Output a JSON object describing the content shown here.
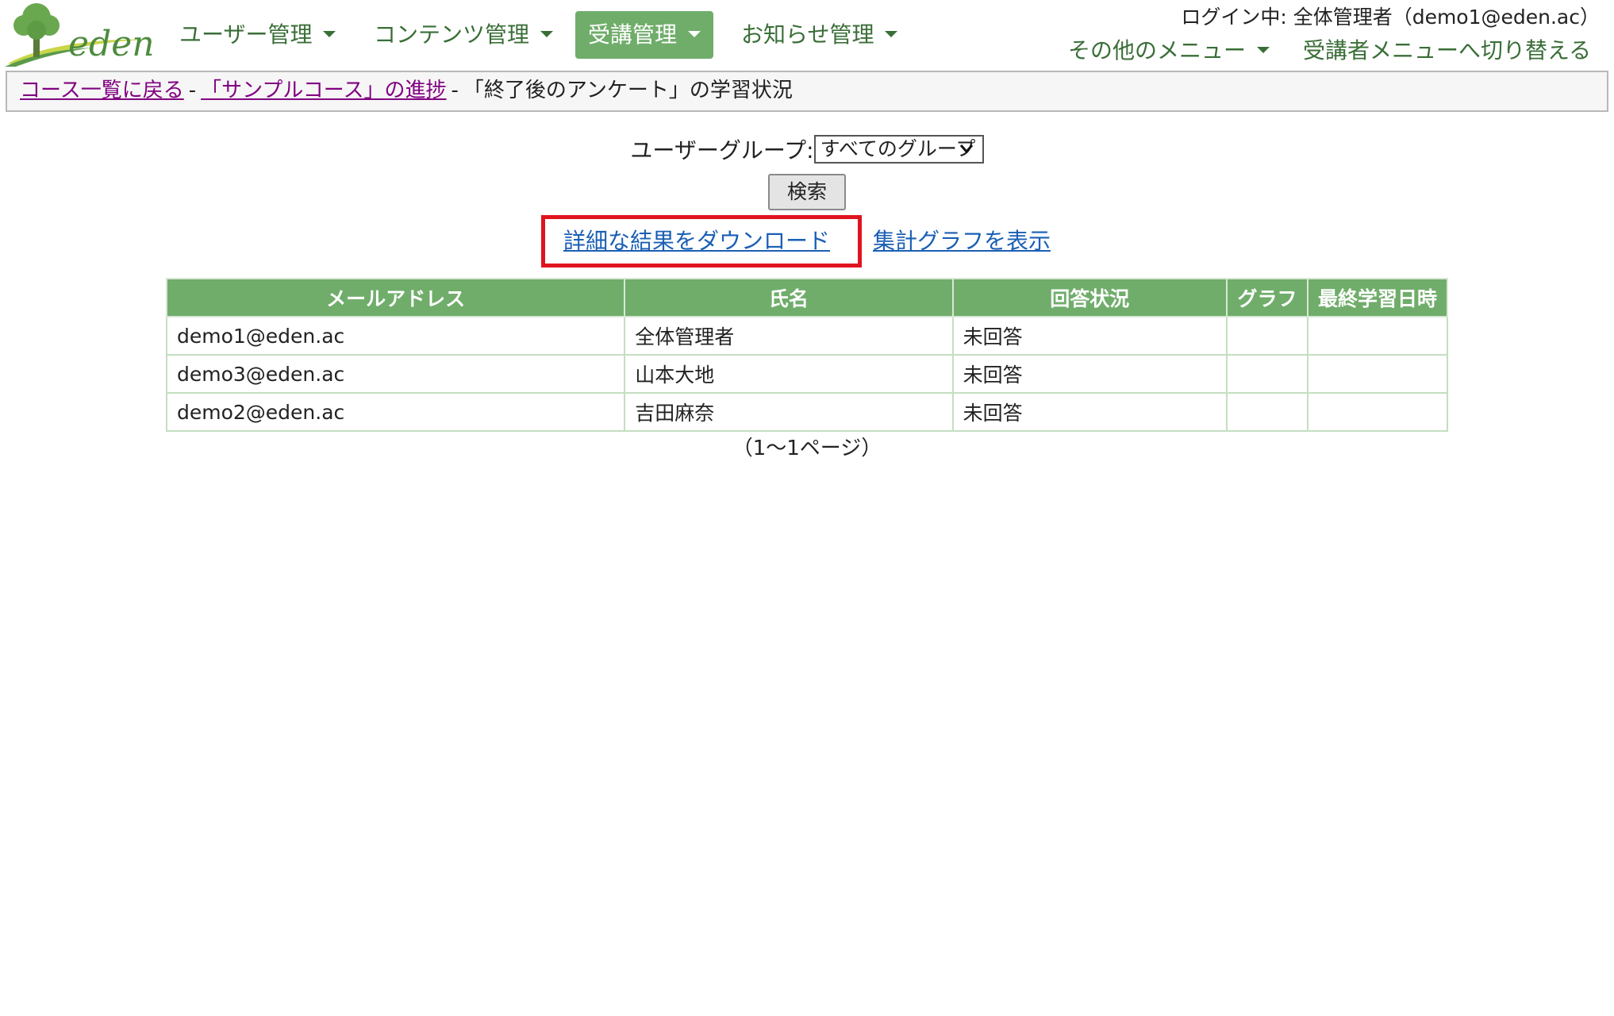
{
  "header": {
    "logo_text": "eden",
    "nav": [
      {
        "label": "ユーザー管理",
        "active": false
      },
      {
        "label": "コンテンツ管理",
        "active": false
      },
      {
        "label": "受講管理",
        "active": true
      },
      {
        "label": "お知らせ管理",
        "active": false
      }
    ],
    "login_info": "ログイン中: 全体管理者（demo1@eden.ac）",
    "other_menu": "その他のメニュー",
    "switch_menu": "受講者メニューへ切り替える"
  },
  "breadcrumb": {
    "link1": "コース一覧に戻る",
    "sep1": "-",
    "link2": "「サンプルコース」の進捗",
    "sep2": "-",
    "current": "「終了後のアンケート」の学習状況"
  },
  "filter": {
    "label": "ユーザーグループ:",
    "select_value": "すべてのグループ",
    "search_button": "検索"
  },
  "links": {
    "download": "詳細な結果をダウンロード",
    "graph": "集計グラフを表示"
  },
  "table": {
    "headers": [
      "メールアドレス",
      "氏名",
      "回答状況",
      "グラフ",
      "最終学習日時"
    ],
    "rows": [
      [
        "demo1@eden.ac",
        "全体管理者",
        "未回答",
        "",
        ""
      ],
      [
        "demo3@eden.ac",
        "山本大地",
        "未回答",
        "",
        ""
      ],
      [
        "demo2@eden.ac",
        "吉田麻奈",
        "未回答",
        "",
        ""
      ]
    ]
  },
  "pager": "（1～1ページ）",
  "colors": {
    "accent_green": "#70ad6b",
    "nav_text": "#3a6e37",
    "link_blue": "#1a5fb4",
    "visited_purple": "#800080",
    "highlight_red": "#e0141e"
  }
}
